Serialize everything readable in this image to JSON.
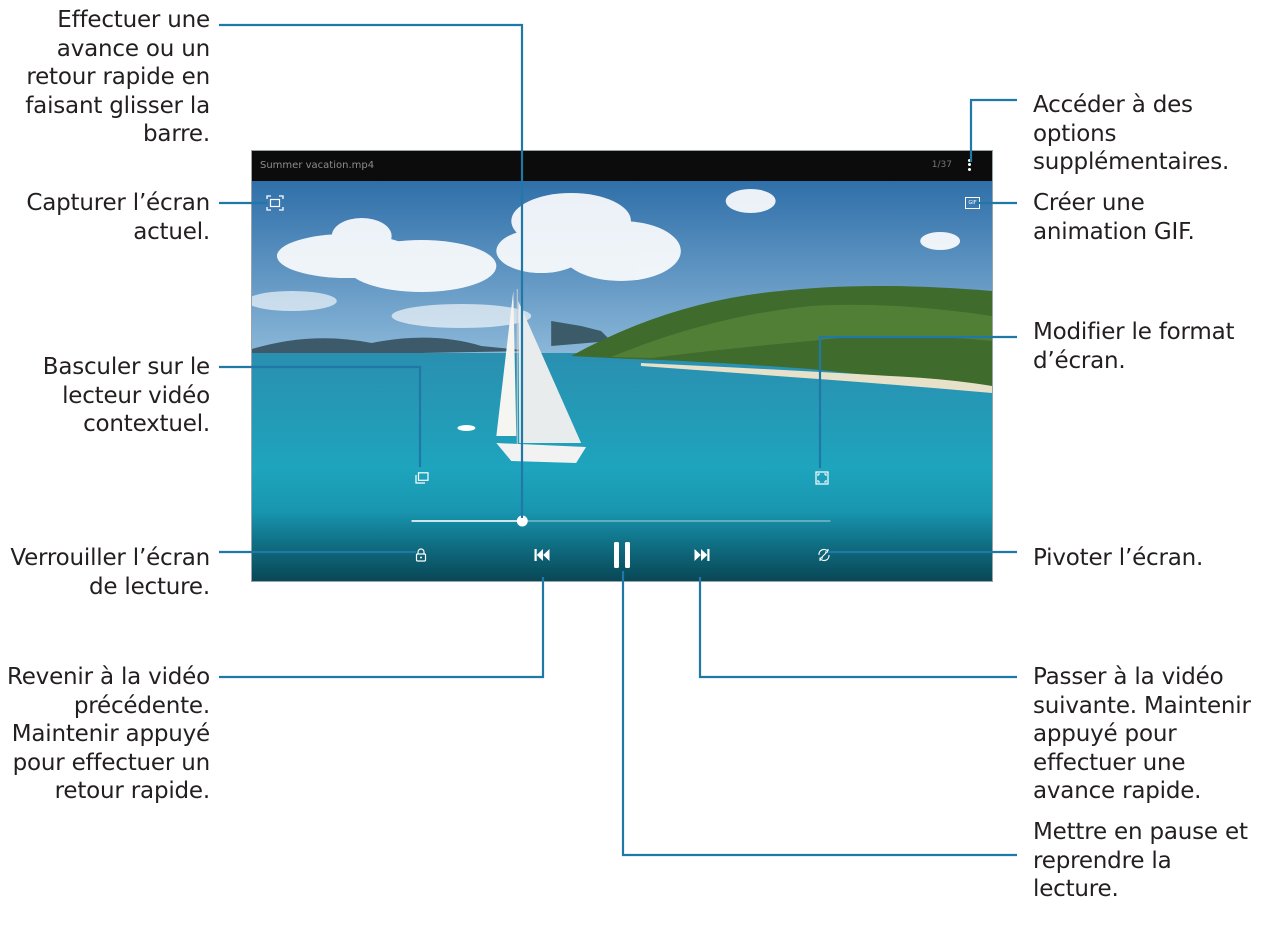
{
  "callouts": {
    "scrub": "Effectuer une\navance ou un\nretour rapide en\nfaisant glisser la\nbarre.",
    "capture": "Capturer l’écran\nactuel.",
    "popup": "Basculer sur le\nlecteur vidéo\ncontextuel.",
    "lock": "Verrouiller l’écran\nde lecture.",
    "previous": "Revenir à la vidéo\nprécédente.\nMaintenir appuyé\npour effectuer un\nretour rapide.",
    "more": "Accéder à des\noptions\nsupplémentaires.",
    "gif": "Créer une\nanimation GIF.",
    "ratio": "Modifier le format\nd’écran.",
    "rotate": "Pivoter l’écran.",
    "next": "Passer à la vidéo\nsuivante. Maintenir\nappuyé pour\neffectuer une\navance rapide.",
    "pause": "Mettre en pause et\nreprendre la\nlecture."
  },
  "player": {
    "title": "Summer vacation.mp4",
    "counter": "1/37",
    "gif_badge": "GIF",
    "progress": 0.27
  },
  "icons": [
    "capture-icon",
    "popup-icon",
    "lock-icon",
    "previous-icon",
    "pause-icon",
    "next-icon",
    "rotate-icon",
    "ratio-icon",
    "gif-icon",
    "more-icon"
  ],
  "colors": {
    "callout_line": "#1f78a5",
    "sea": "#1d9bb3",
    "sky": "#4f8fc2"
  }
}
